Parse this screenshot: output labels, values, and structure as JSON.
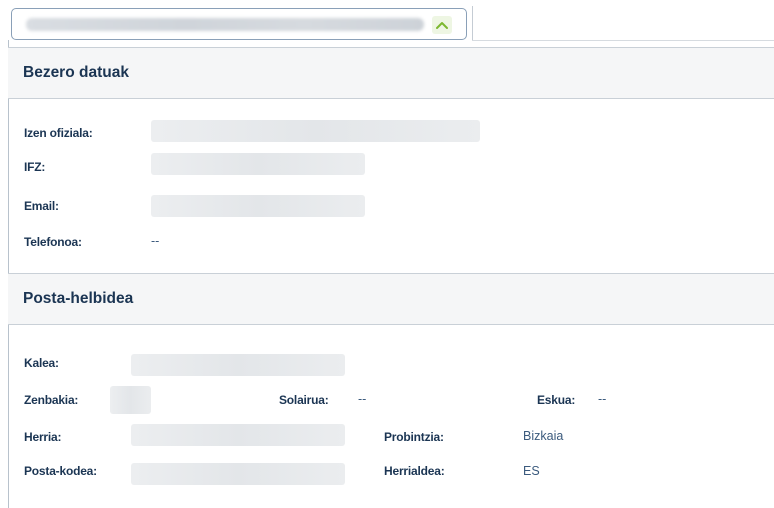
{
  "selector": {
    "value": "",
    "expand_icon": "chevron-up-icon",
    "accent": "#7cb82f"
  },
  "client": {
    "title": "Bezero datuak",
    "fields": {
      "official_name": {
        "label": "Izen ofiziala:",
        "value": ""
      },
      "tax_id": {
        "label": "IFZ:",
        "value": ""
      },
      "email": {
        "label": "Email:",
        "value": ""
      },
      "phone": {
        "label": "Telefonoa:",
        "value": "--"
      }
    }
  },
  "address": {
    "title": "Posta-helbidea",
    "fields": {
      "street": {
        "label": "Kalea:",
        "value": ""
      },
      "number": {
        "label": "Zenbakia:",
        "value": ""
      },
      "floor": {
        "label": "Solairua:",
        "value": "--"
      },
      "hand": {
        "label": "Eskua:",
        "value": "--"
      },
      "town": {
        "label": "Herria:",
        "value": ""
      },
      "province": {
        "label": "Probintzia:",
        "value": "Bizkaia"
      },
      "postal_code": {
        "label": "Posta-kodea:",
        "value": ""
      },
      "country": {
        "label": "Herrialdea:",
        "value": "ES"
      }
    }
  }
}
